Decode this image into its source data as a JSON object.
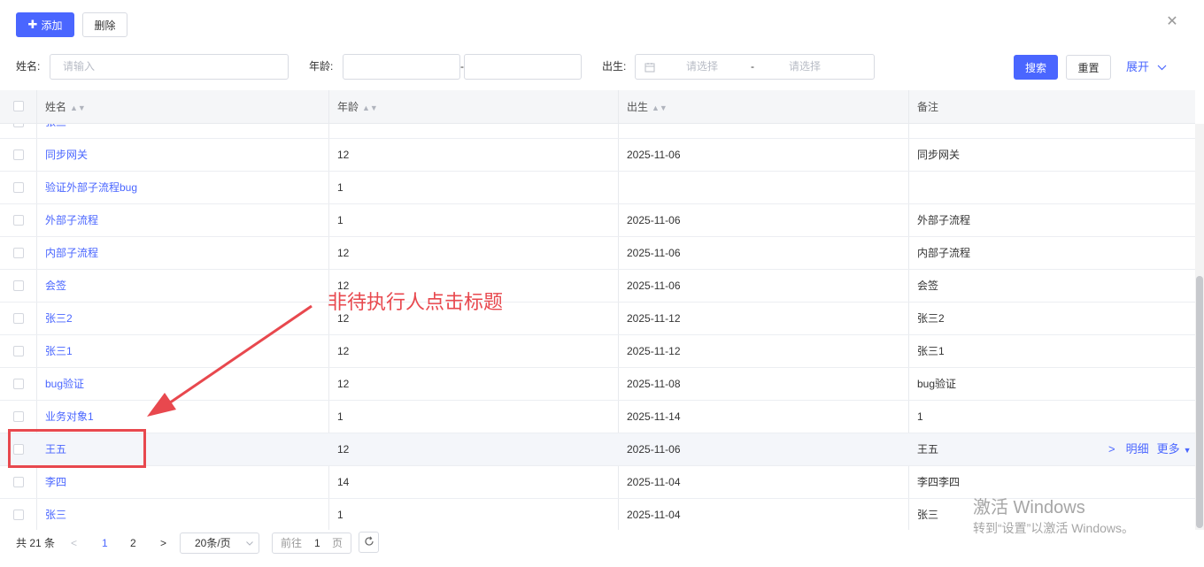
{
  "toolbar": {
    "add_label": "添加",
    "delete_label": "删除"
  },
  "search": {
    "name_label": "姓名:",
    "name_placeholder": "请输入",
    "age_label": "年龄:",
    "age_sep": "-",
    "birth_label": "出生:",
    "birth_start_placeholder": "请选择",
    "birth_sep": "-",
    "birth_end_placeholder": "请选择",
    "search_label": "搜索",
    "reset_label": "重置",
    "expand_label": "展开"
  },
  "table": {
    "columns": [
      "姓名",
      "年龄",
      "出生",
      "备注"
    ],
    "partial_row": {
      "name": "张三",
      "age": "",
      "birth": "",
      "note": ""
    },
    "rows": [
      {
        "name": "同步网关",
        "age": "12",
        "birth": "2025-11-06",
        "note": "同步网关"
      },
      {
        "name": "验证外部子流程bug",
        "age": "1",
        "birth": "",
        "note": ""
      },
      {
        "name": "外部子流程",
        "age": "1",
        "birth": "2025-11-06",
        "note": "外部子流程"
      },
      {
        "name": "内部子流程",
        "age": "12",
        "birth": "2025-11-06",
        "note": "内部子流程"
      },
      {
        "name": "会签",
        "age": "12",
        "birth": "2025-11-06",
        "note": "会签"
      },
      {
        "name": "张三2",
        "age": "12",
        "birth": "2025-11-12",
        "note": "张三2"
      },
      {
        "name": "张三1",
        "age": "12",
        "birth": "2025-11-12",
        "note": "张三1"
      },
      {
        "name": "bug验证",
        "age": "12",
        "birth": "2025-11-08",
        "note": "bug验证"
      },
      {
        "name": "业务对象1",
        "age": "1",
        "birth": "2025-11-14",
        "note": "1"
      },
      {
        "name": "王五",
        "age": "12",
        "birth": "2025-11-06",
        "note": "王五"
      },
      {
        "name": "李四",
        "age": "14",
        "birth": "2025-11-04",
        "note": "李四李四"
      },
      {
        "name": "张三",
        "age": "1",
        "birth": "2025-11-04",
        "note": "张三"
      }
    ],
    "row_actions": {
      "detail_label": "明细",
      "more_label": "更多"
    }
  },
  "pagination": {
    "total_text": "共 21 条",
    "pages": [
      "1",
      "2"
    ],
    "current_page": "1",
    "page_size": "20条/页",
    "goto_label": "前往",
    "goto_value": "1",
    "page_unit": "页"
  },
  "annotation": {
    "text": "非待执行人点击标题"
  },
  "watermark": {
    "line1": "激活 Windows",
    "line2": "转到“设置”以激活 Windows。"
  },
  "colors": {
    "primary": "#4a66ff",
    "annotation": "#e8484e"
  }
}
